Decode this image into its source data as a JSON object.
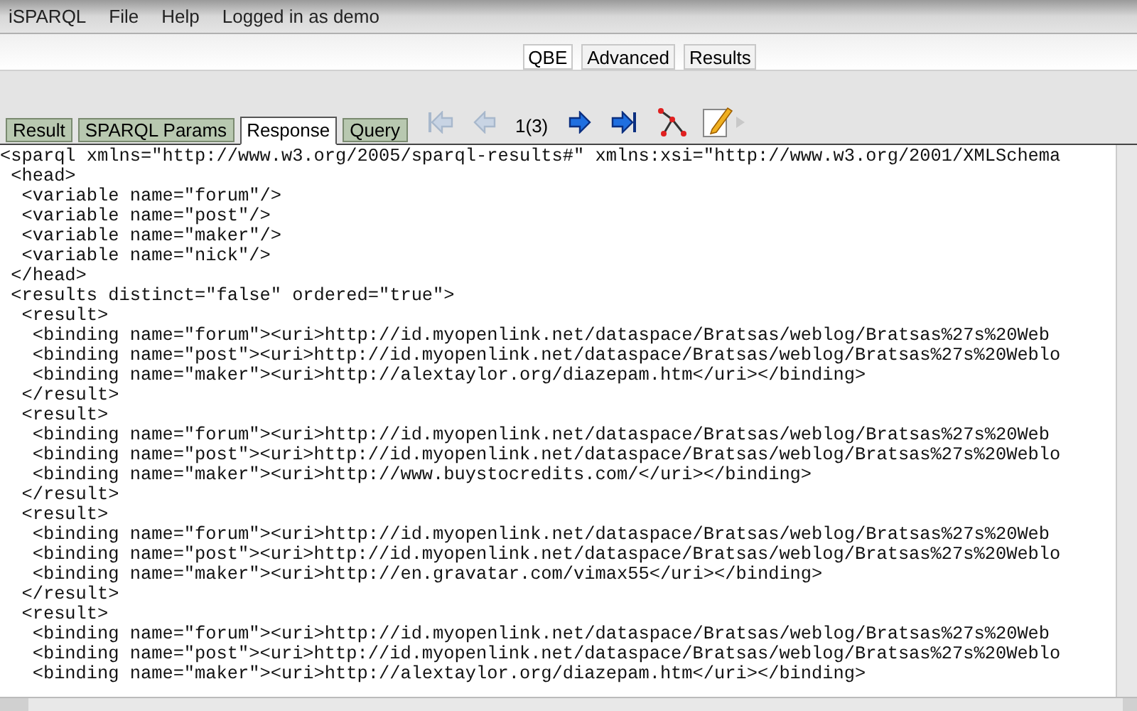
{
  "menu": [
    "iSPARQL",
    "File",
    "Help",
    "Logged in as demo"
  ],
  "mode_tabs": [
    {
      "label": "QBE",
      "selected": true
    },
    {
      "label": "Advanced",
      "selected": false
    },
    {
      "label": "Results",
      "selected": false
    }
  ],
  "result_tabs": [
    {
      "label": "Result",
      "selected": false
    },
    {
      "label": "SPARQL Params",
      "selected": false
    },
    {
      "label": "Response",
      "selected": true
    },
    {
      "label": "Query",
      "selected": false
    }
  ],
  "pager": {
    "first_disabled": true,
    "prev_disabled": true,
    "page": "1(3)",
    "next_disabled": false,
    "last_disabled": false
  },
  "code_lines": [
    "<sparql xmlns=\"http://www.w3.org/2005/sparql-results#\" xmlns:xsi=\"http://www.w3.org/2001/XMLSchema",
    " <head>",
    "  <variable name=\"forum\"/>",
    "  <variable name=\"post\"/>",
    "  <variable name=\"maker\"/>",
    "  <variable name=\"nick\"/>",
    " </head>",
    " <results distinct=\"false\" ordered=\"true\">",
    "  <result>",
    "   <binding name=\"forum\"><uri>http://id.myopenlink.net/dataspace/Bratsas/weblog/Bratsas%27s%20Web",
    "   <binding name=\"post\"><uri>http://id.myopenlink.net/dataspace/Bratsas/weblog/Bratsas%27s%20Weblo",
    "   <binding name=\"maker\"><uri>http://alextaylor.org/diazepam.htm</uri></binding>",
    "  </result>",
    "  <result>",
    "   <binding name=\"forum\"><uri>http://id.myopenlink.net/dataspace/Bratsas/weblog/Bratsas%27s%20Web",
    "   <binding name=\"post\"><uri>http://id.myopenlink.net/dataspace/Bratsas/weblog/Bratsas%27s%20Weblo",
    "   <binding name=\"maker\"><uri>http://www.buystocredits.com/</uri></binding>",
    "  </result>",
    "  <result>",
    "   <binding name=\"forum\"><uri>http://id.myopenlink.net/dataspace/Bratsas/weblog/Bratsas%27s%20Web",
    "   <binding name=\"post\"><uri>http://id.myopenlink.net/dataspace/Bratsas/weblog/Bratsas%27s%20Weblo",
    "   <binding name=\"maker\"><uri>http://en.gravatar.com/vimax55</uri></binding>",
    "  </result>",
    "  <result>",
    "   <binding name=\"forum\"><uri>http://id.myopenlink.net/dataspace/Bratsas/weblog/Bratsas%27s%20Web",
    "   <binding name=\"post\"><uri>http://id.myopenlink.net/dataspace/Bratsas/weblog/Bratsas%27s%20Weblo",
    "   <binding name=\"maker\"><uri>http://alextaylor.org/diazepam.htm</uri></binding>"
  ]
}
